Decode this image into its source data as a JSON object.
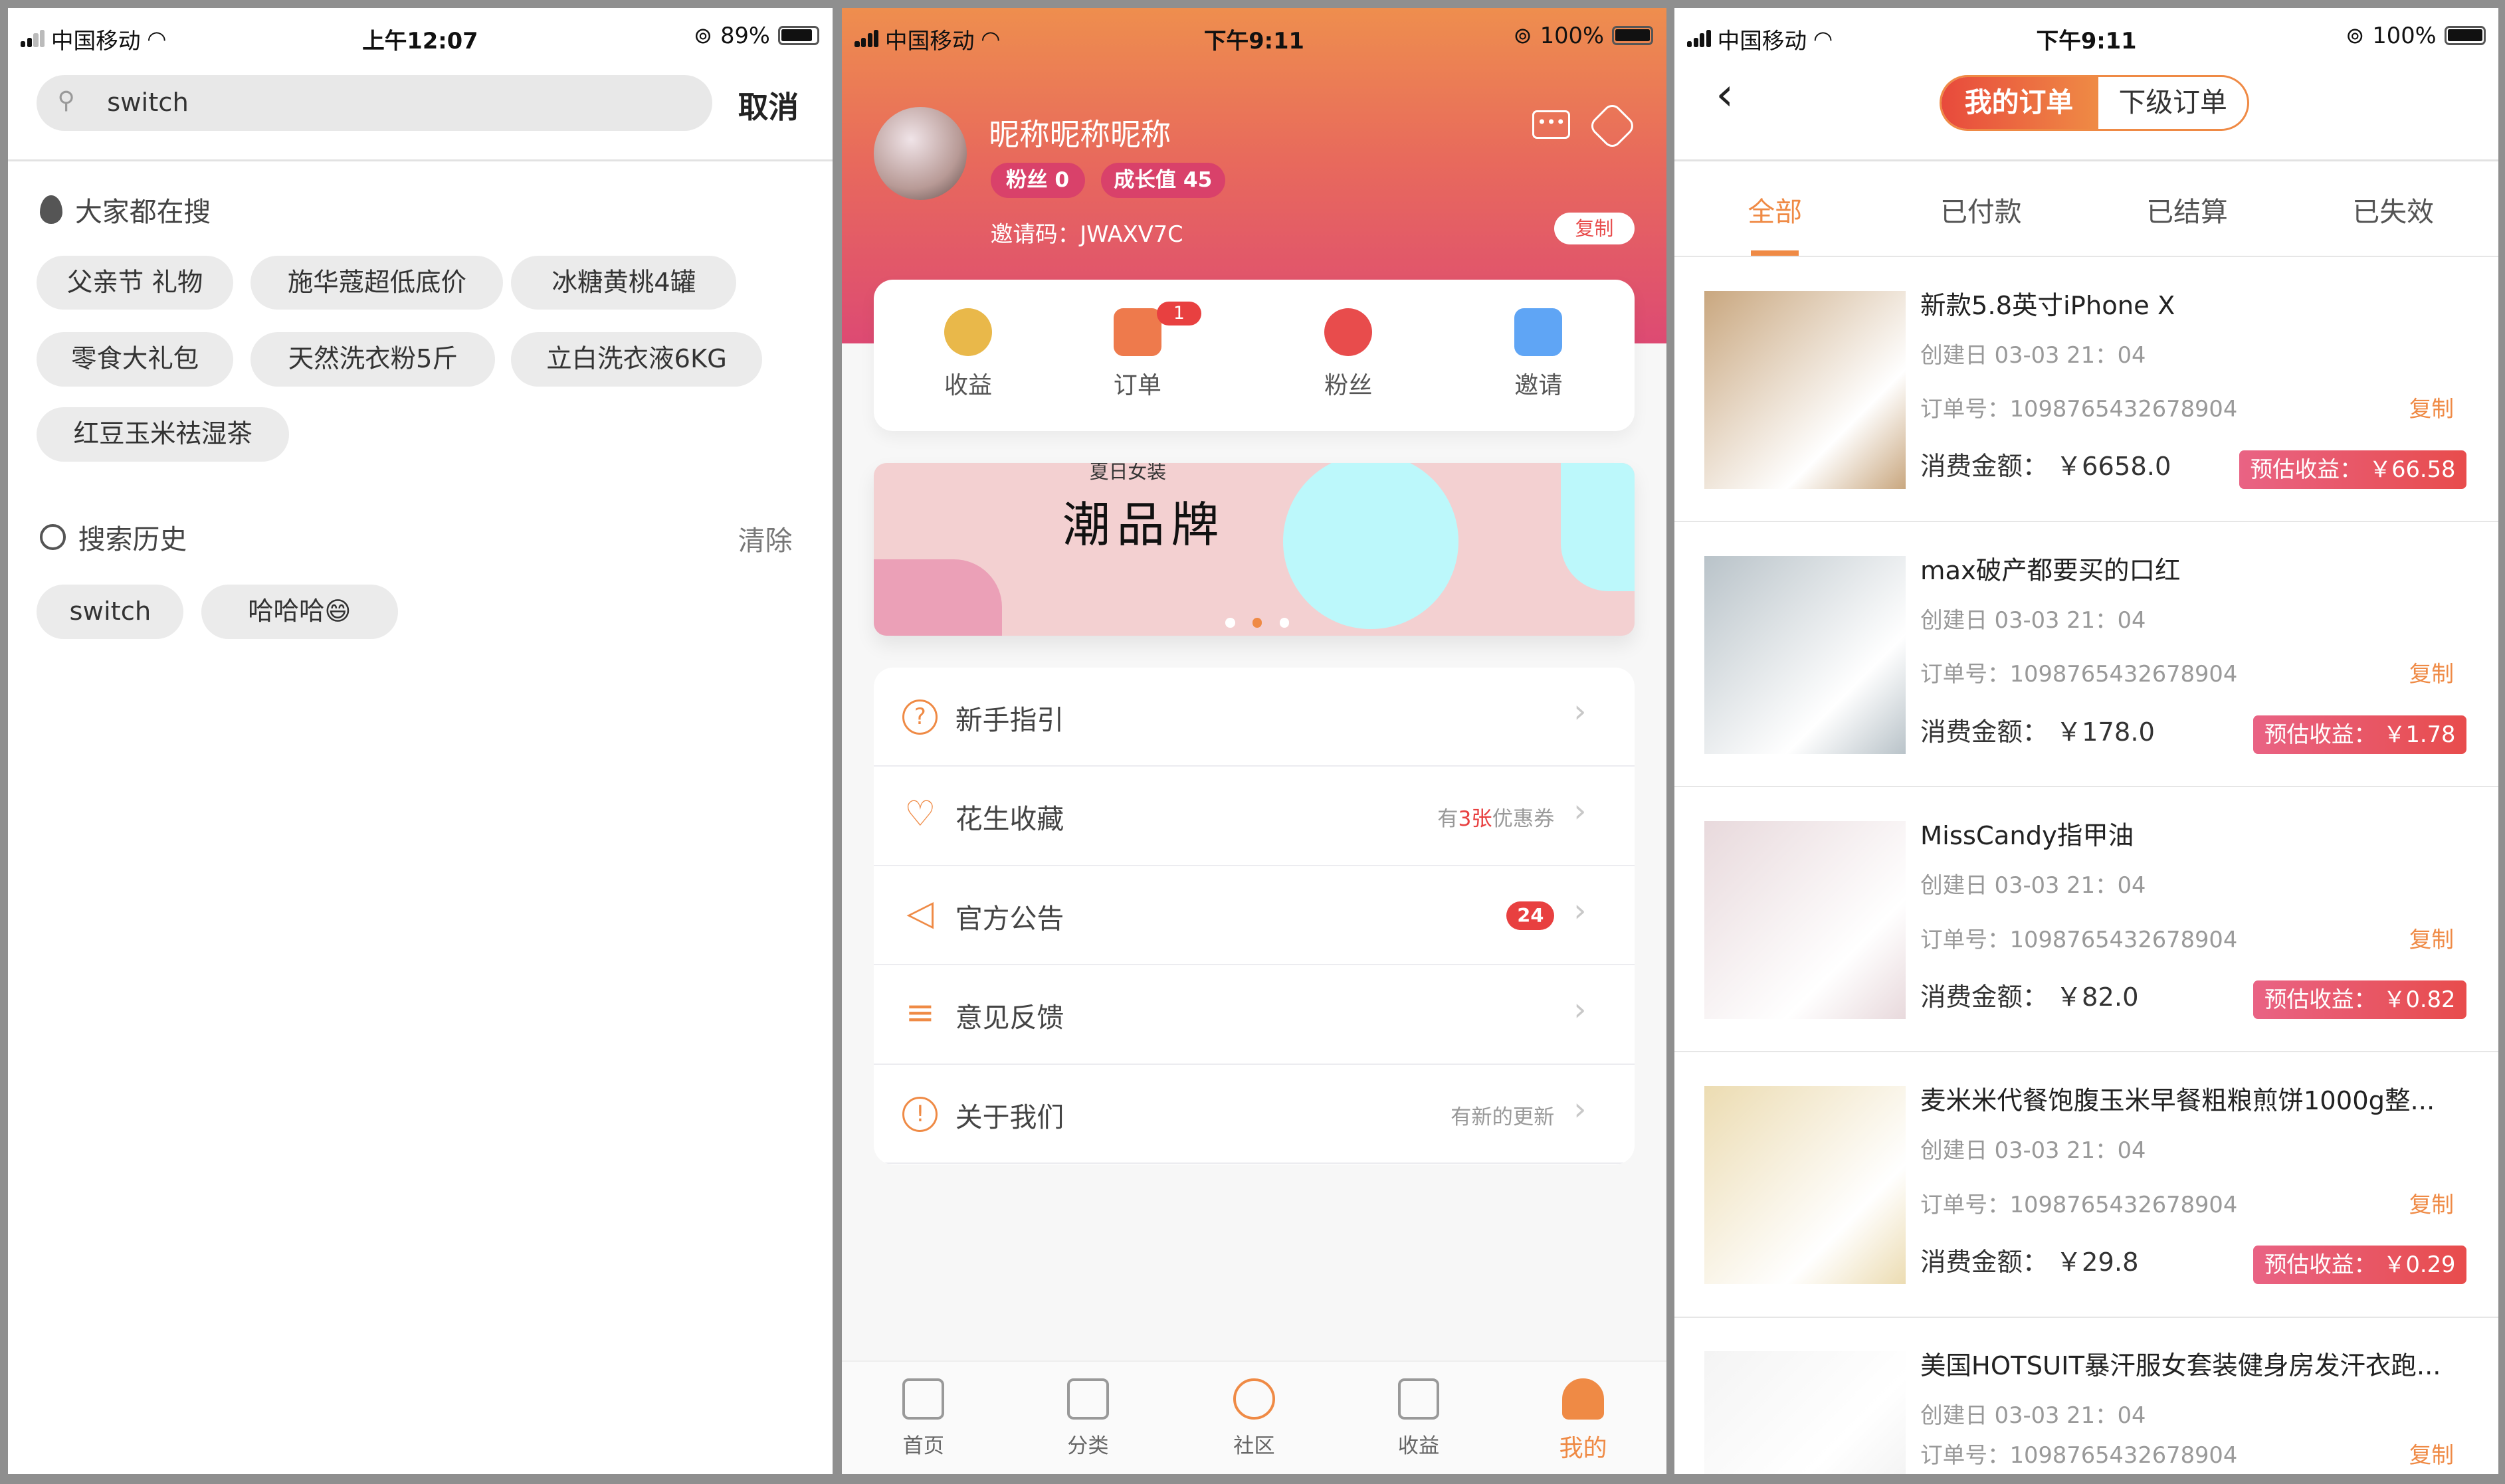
{
  "colors": {
    "accent": "#ef8a45",
    "red": "#e84c4c",
    "badge_bg": "#d9416a"
  },
  "search_screen": {
    "status": {
      "carrier": "中国移动",
      "time": "上午12:07",
      "battery": "89%",
      "battery_level": 0.89
    },
    "search": {
      "value": "switch",
      "icon": "search-icon",
      "cancel": "取消"
    },
    "hot": {
      "title": "大家都在搜",
      "icon": "fire-icon",
      "tags": [
        "父亲节 礼物",
        "施华蔻超低底价",
        "冰糖黄桃4罐",
        "零食大礼包",
        "天然洗衣粉5斤",
        "立白洗衣液6KG",
        "红豆玉米祛湿茶"
      ]
    },
    "history": {
      "title": "搜索历史",
      "icon": "history-icon",
      "clear": "清除",
      "tags": [
        "switch",
        "哈哈哈😄"
      ]
    }
  },
  "profile_screen": {
    "status": {
      "carrier": "中国移动",
      "time": "下午9:11",
      "battery": "100%",
      "battery_level": 1.0
    },
    "user": {
      "nickname": "昵称昵称昵称",
      "fans_badge": "粉丝 0",
      "growth_badge": "成长值 45",
      "invite_code": "邀请码：JWAXV7C",
      "copy": "复制"
    },
    "quick": [
      {
        "label": "收益",
        "icon": "yuan-coin-icon",
        "color": "#e9b84a"
      },
      {
        "label": "订单",
        "icon": "order-list-icon",
        "color": "#ee7a4c",
        "badge": "1"
      },
      {
        "label": "粉丝",
        "icon": "user-heart-icon",
        "color": "#e84c4c"
      },
      {
        "label": "邀请",
        "icon": "envelope-heart-icon",
        "color": "#5fa5f5"
      }
    ],
    "banner": {
      "subtitle": "夏日女装",
      "title": "潮品牌",
      "active_dot": 1,
      "dots": 3
    },
    "menu": [
      {
        "label": "新手指引",
        "icon": "question-icon",
        "right": ""
      },
      {
        "label": "花生收藏",
        "icon": "heart-icon",
        "right_pre": "有",
        "right_hl": "3张",
        "right_post": "优惠券"
      },
      {
        "label": "官方公告",
        "icon": "speaker-icon",
        "count": "24"
      },
      {
        "label": "意见反馈",
        "icon": "feedback-icon",
        "right": ""
      },
      {
        "label": "关于我们",
        "icon": "info-icon",
        "right": "有新的更新"
      }
    ],
    "tabbar": [
      {
        "label": "首页",
        "icon": "home-icon",
        "active": false
      },
      {
        "label": "分类",
        "icon": "category-icon",
        "active": false
      },
      {
        "label": "社区",
        "icon": "community-icon",
        "active": false
      },
      {
        "label": "收益",
        "icon": "chart-icon",
        "active": false
      },
      {
        "label": "我的",
        "icon": "profile-icon",
        "active": true
      }
    ]
  },
  "orders_screen": {
    "status": {
      "carrier": "中国移动",
      "time": "下午9:11",
      "battery": "100%",
      "battery_level": 1.0
    },
    "segments": [
      "我的订单",
      "下级订单"
    ],
    "tabs": [
      "全部",
      "已付款",
      "已结算",
      "已失效"
    ],
    "orders": [
      {
        "title": "新款5.8英寸iPhone X",
        "date": "创建日 03-03 21：04",
        "no": "订单号：1098765432678904",
        "copy": "复制",
        "amount": "消费金额： ￥6658.0",
        "earn": "预估收益： ￥66.58",
        "img": "#c9a77f"
      },
      {
        "title": "max破产都要买的口红",
        "date": "创建日 03-03 21：04",
        "no": "订单号：1098765432678904",
        "copy": "复制",
        "amount": "消费金额： ￥178.0",
        "earn": "预估收益： ￥1.78",
        "img": "#b9c3c9"
      },
      {
        "title": "MissCandy指甲油",
        "date": "创建日 03-03 21：04",
        "no": "订单号：1098765432678904",
        "copy": "复制",
        "amount": "消费金额： ￥82.0",
        "earn": "预估收益： ￥0.82",
        "img": "#e8d9dc"
      },
      {
        "title": "麦米米代餐饱腹玉米早餐粗粮煎饼1000g整...",
        "date": "创建日 03-03 21：04",
        "no": "订单号：1098765432678904",
        "copy": "复制",
        "amount": "消费金额： ￥29.8",
        "earn": "预估收益： ￥0.29",
        "img": "#ecdcb2"
      },
      {
        "title": "美国HOTSUIT暴汗服女套装健身房发汗衣跑...",
        "date": "创建日 03-03 21：04",
        "no": "订单号：1098765432678904",
        "copy": "复制",
        "amount": "",
        "earn": "",
        "img": "#f4f4f4"
      }
    ]
  }
}
